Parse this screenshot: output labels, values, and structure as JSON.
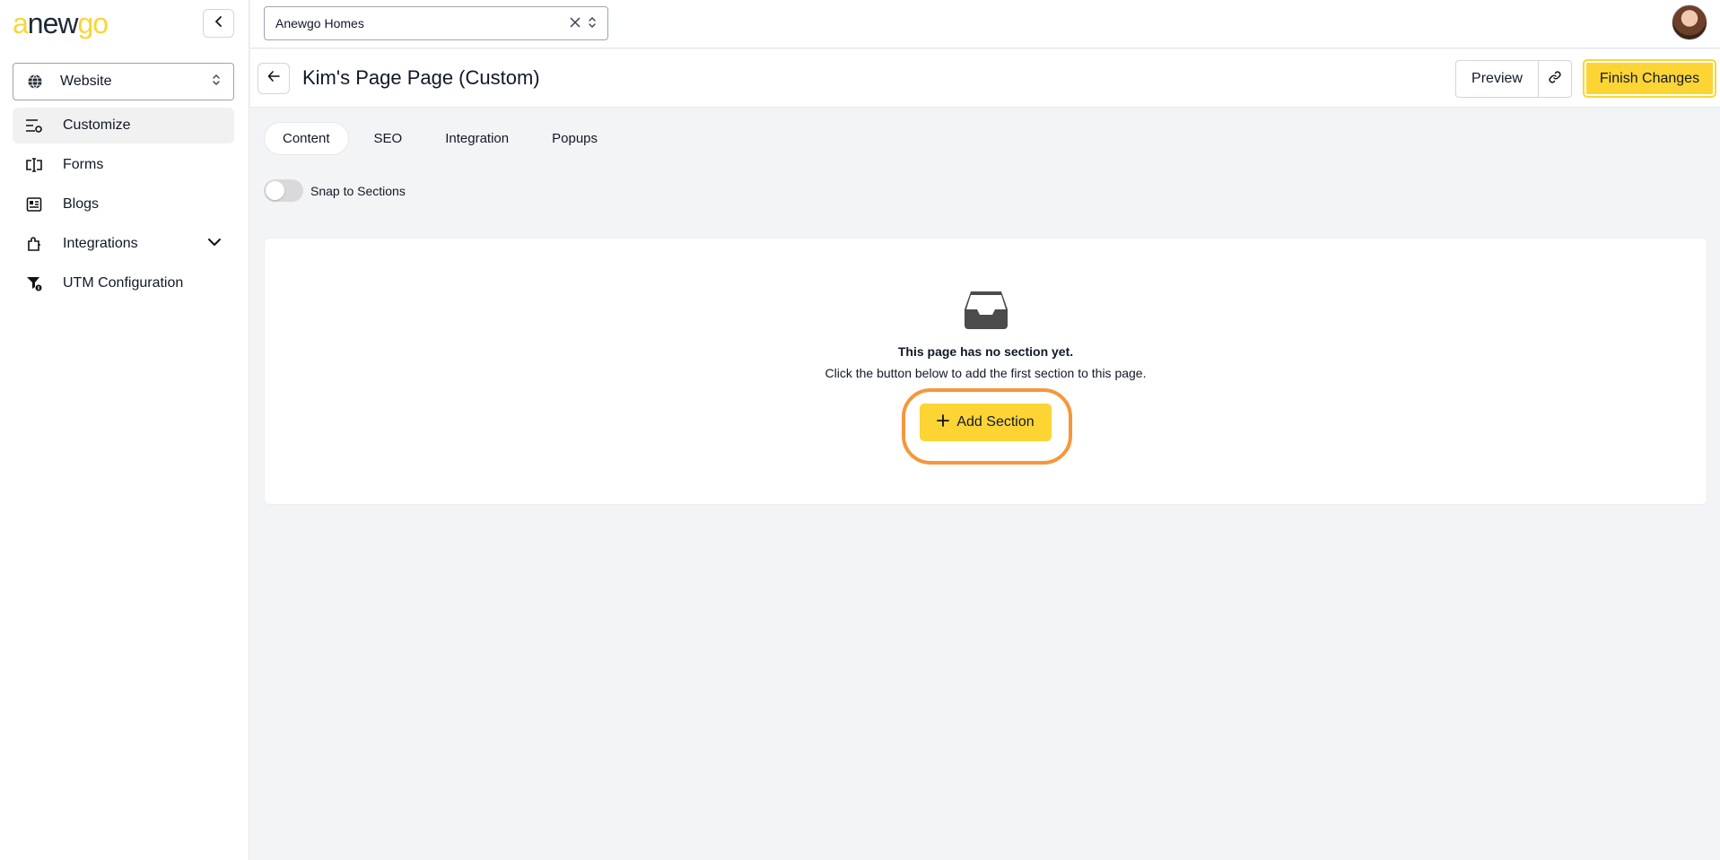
{
  "brand": {
    "logo_text_1": "a",
    "logo_text_2": "new",
    "logo_text_3": "go",
    "accent": "#fcd535"
  },
  "sidebar": {
    "site_select": {
      "label": "Website",
      "icon": "globe-icon"
    },
    "items": [
      {
        "label": "Customize",
        "icon": "sliders-icon",
        "active": true
      },
      {
        "label": "Forms",
        "icon": "form-field-icon"
      },
      {
        "label": "Blogs",
        "icon": "newspaper-icon"
      },
      {
        "label": "Integrations",
        "icon": "puzzle-icon",
        "has_dropdown": true
      },
      {
        "label": "UTM Configuration",
        "icon": "funnel-icon"
      }
    ]
  },
  "topbar": {
    "company_select": {
      "value": "Anewgo Homes"
    }
  },
  "header": {
    "title": "Kim's Page Page (Custom)",
    "preview_label": "Preview",
    "finish_label": "Finish Changes"
  },
  "tabs": [
    {
      "label": "Content",
      "active": true
    },
    {
      "label": "SEO"
    },
    {
      "label": "Integration"
    },
    {
      "label": "Popups"
    }
  ],
  "snap": {
    "label": "Snap to Sections",
    "on": false
  },
  "empty_state": {
    "icon": "inbox-icon",
    "title": "This page has no section yet.",
    "description": "Click the button below to add the first section to this page.",
    "button_label": "Add Section",
    "highlight_color": "#f7963b"
  }
}
